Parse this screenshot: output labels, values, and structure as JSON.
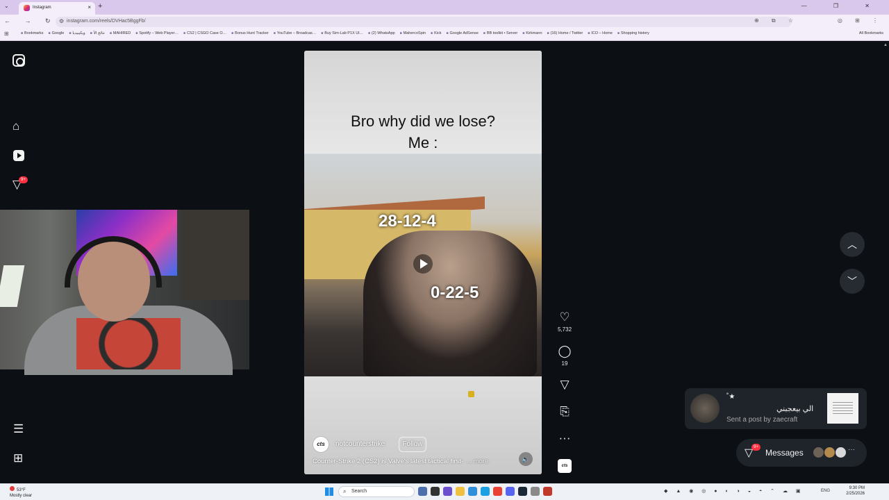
{
  "browser": {
    "tab_title": "Instagram",
    "url": "instagram.com/reels/DVHac5BggFb/",
    "new_tab": "+",
    "tab_close": "×",
    "tab_dropdown": "⌄",
    "window_controls": "— ❐ ✕",
    "nav_buttons": "← → ↻ ⌂",
    "url_icons": "⊕ ⧉ ☆",
    "extension_icons": "◎ ⊞ ⋮",
    "apps_icon": "⊞",
    "bookmarks": [
      "Bookmarks",
      "Google",
      "ويكيبيديا",
      "نتائج الأ",
      "MAHIRED",
      "Spotify – Web Player…",
      "CS2 | CSGO Case O…",
      "Bonus Hunt Tracker",
      "YouTube – Broadcas…",
      "Buy Sim-Lab P1X Ul…",
      "(2) WhatsApp",
      "MahercoSpin",
      "Kick",
      "Google AdSense",
      "BB toolkit • Server",
      "Kirkmann",
      "(16) Home / Twitter",
      "ICO – Home",
      "Shopping history"
    ],
    "all_bookmarks": "All Bookmarks"
  },
  "sidebar": {
    "notification_badge": "9+",
    "home_icon": "⌂",
    "send_icon": "▽",
    "menu_icon": "☰",
    "more_icon": "⊞"
  },
  "reel": {
    "caption_line1": "Bro why did we lose?",
    "caption_line2": "Me :",
    "score_top": "28-12-4",
    "score_bottom": "0-22-5",
    "author_avatar_text": "cts",
    "author": "notcounterstrike",
    "follow_label": "Follow",
    "description": "Counter-Strike 2 (CS2) is Valve's latest tactical first-",
    "description_more": "... more",
    "mute_icon": "🔈"
  },
  "actions": {
    "like_icon": "♡",
    "like_count": "5,732",
    "comment_icon": "◯",
    "comment_count": "19",
    "share_icon": "▽",
    "save_icon": "⎘",
    "more_icon": "···",
    "audio_text": "cts"
  },
  "navigation": {
    "up_icon": "︿",
    "down_icon": "﹀"
  },
  "toast": {
    "stars": "˚★",
    "message": "الي بيعجبني",
    "subtitle": "Sent a post by zaecraft"
  },
  "messages": {
    "icon": "▽",
    "badge": "9+",
    "label": "Messages",
    "more": "···"
  },
  "scrollbar": {
    "arrow": "▲"
  },
  "taskbar": {
    "weather_temp": "53°F",
    "weather_desc": "Mostly clear",
    "search_placeholder": "Search",
    "search_icon": "⌕",
    "tray_icons": "◆ ▲ ◉ ◎ ● ◐ ◑ ◒ ◓ ⌃ ☁ ▣",
    "language": "ENG",
    "time": "9:30 PM",
    "date": "2/25/2026"
  },
  "colors": {
    "instagram_bg": "#0c0f14",
    "badge_red": "#ff3040",
    "tab_bar": "#d9c7ec",
    "toast_bg": "#1f242b"
  }
}
